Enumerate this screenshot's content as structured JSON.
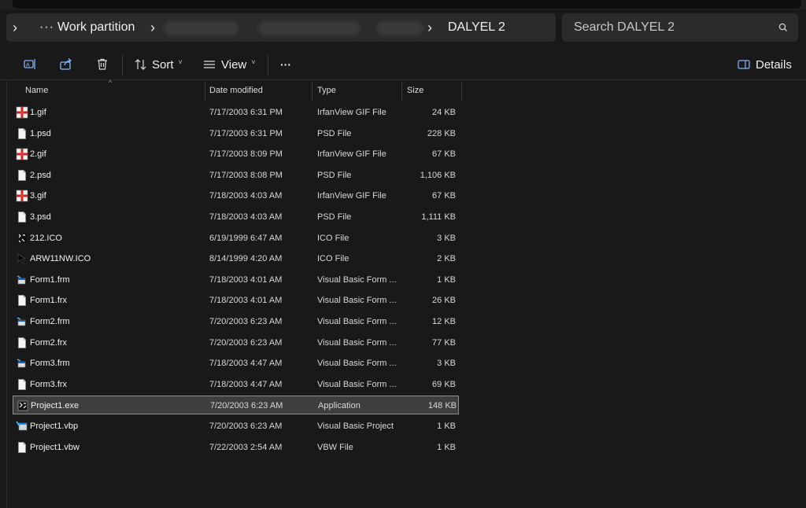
{
  "address": {
    "crumbs": [
      "Work partition",
      "DALYEL 2"
    ],
    "overflow": "···"
  },
  "search": {
    "placeholder": "Search DALYEL 2"
  },
  "toolbar": {
    "sort_label": "Sort",
    "view_label": "View",
    "more_label": "···",
    "details_label": "Details"
  },
  "columns": {
    "name": "Name",
    "date": "Date modified",
    "type": "Type",
    "size": "Size"
  },
  "files": [
    {
      "name": "1.gif",
      "date": "7/17/2003 6:31 PM",
      "type": "IrfanView GIF File",
      "size": "24 KB",
      "icon": "gif-image-icon"
    },
    {
      "name": "1.psd",
      "date": "7/17/2003 6:31 PM",
      "type": "PSD File",
      "size": "228 KB",
      "icon": "document-icon"
    },
    {
      "name": "2.gif",
      "date": "7/17/2003 8:09 PM",
      "type": "IrfanView GIF File",
      "size": "67 KB",
      "icon": "gif-image-icon"
    },
    {
      "name": "2.psd",
      "date": "7/17/2003 8:08 PM",
      "type": "PSD File",
      "size": "1,106 KB",
      "icon": "document-icon"
    },
    {
      "name": "3.gif",
      "date": "7/18/2003 4:03 AM",
      "type": "IrfanView GIF File",
      "size": "67 KB",
      "icon": "gif-image-icon"
    },
    {
      "name": "3.psd",
      "date": "7/18/2003 4:03 AM",
      "type": "PSD File",
      "size": "1,111 KB",
      "icon": "document-icon"
    },
    {
      "name": "212.ICO",
      "date": "6/19/1999 6:47 AM",
      "type": "ICO File",
      "size": "3 KB",
      "icon": "ico-file-icon"
    },
    {
      "name": "ARW11NW.ICO",
      "date": "8/14/1999 4:20 AM",
      "type": "ICO File",
      "size": "2 KB",
      "icon": "arrow-ico-icon"
    },
    {
      "name": "Form1.frm",
      "date": "7/18/2003 4:01 AM",
      "type": "Visual Basic Form ...",
      "size": "1 KB",
      "icon": "vb-form-icon"
    },
    {
      "name": "Form1.frx",
      "date": "7/18/2003 4:01 AM",
      "type": "Visual Basic Form ...",
      "size": "26 KB",
      "icon": "document-icon"
    },
    {
      "name": "Form2.frm",
      "date": "7/20/2003 6:23 AM",
      "type": "Visual Basic Form ...",
      "size": "12 KB",
      "icon": "vb-form-icon"
    },
    {
      "name": "Form2.frx",
      "date": "7/20/2003 6:23 AM",
      "type": "Visual Basic Form ...",
      "size": "77 KB",
      "icon": "document-icon"
    },
    {
      "name": "Form3.frm",
      "date": "7/18/2003 4:47 AM",
      "type": "Visual Basic Form ...",
      "size": "3 KB",
      "icon": "vb-form-icon"
    },
    {
      "name": "Form3.frx",
      "date": "7/18/2003 4:47 AM",
      "type": "Visual Basic Form ...",
      "size": "69 KB",
      "icon": "document-icon"
    },
    {
      "name": "Project1.exe",
      "date": "7/20/2003 6:23 AM",
      "type": "Application",
      "size": "148 KB",
      "icon": "exe-app-icon",
      "selected": true
    },
    {
      "name": "Project1.vbp",
      "date": "7/20/2003 6:23 AM",
      "type": "Visual Basic Project",
      "size": "1 KB",
      "icon": "vb-project-icon"
    },
    {
      "name": "Project1.vbw",
      "date": "7/22/2003 2:54 AM",
      "type": "VBW File",
      "size": "1 KB",
      "icon": "document-icon"
    }
  ],
  "colors": {
    "background": "#191919",
    "bar": "#2b2b2b",
    "selection": "#3e3e3e",
    "selection_border": "#8d8d8d"
  }
}
